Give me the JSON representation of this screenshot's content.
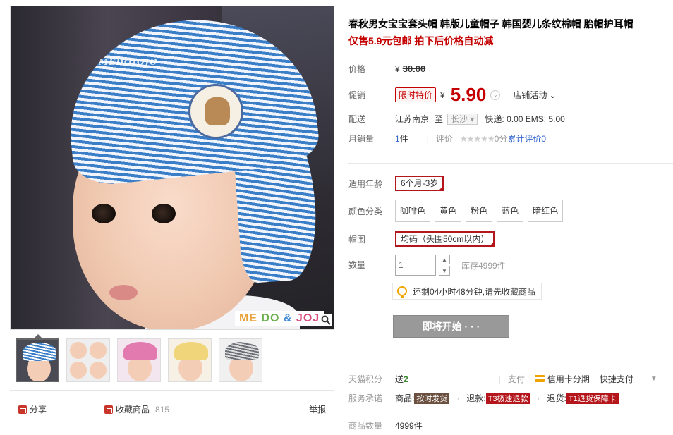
{
  "gallery": {
    "main_watermark": "MEDOJOJO",
    "brand_letters": [
      "ME",
      "DO",
      "&",
      "JOJ"
    ],
    "thumb_colors": [
      "#5a8ed0",
      "#c7a0c0",
      "#e27ab0",
      "#f1d57a",
      "#8b8f98"
    ]
  },
  "share": {
    "share_label": "分享",
    "favorite_label": "收藏商品",
    "favorite_count": "815",
    "report_label": "举报"
  },
  "product": {
    "title": "春秋男女宝宝套头帽 韩版儿童帽子 韩国婴儿条纹棉帽 胎帽护耳帽",
    "subtitle": "仅售5.9元包邮 拍下后价格自动减"
  },
  "price": {
    "label": "价格",
    "currency": "¥",
    "original": "30.00",
    "promo_label": "促销",
    "promo_tag": "限时特价",
    "current": "5.90",
    "store_activity": "店铺活动"
  },
  "shipping": {
    "label": "配送",
    "from": "江苏南京",
    "to_word": "至",
    "destination": "长沙",
    "fees": "快递: 0.00 EMS: 5.00"
  },
  "sales": {
    "label": "月销量",
    "count": "1",
    "unit": "件",
    "review_label": "评价",
    "stars": "★★★★★",
    "score": "0分",
    "total_reviews_label": "累计评价",
    "total_reviews": "0"
  },
  "options": {
    "age_label": "适用年龄",
    "age_value": "6个月-3岁",
    "color_label": "颜色分类",
    "colors": [
      "咖啡色",
      "黄色",
      "粉色",
      "蓝色",
      "暗红色"
    ],
    "size_label": "帽围",
    "size_value": "均码（头围50cm以内）",
    "qty_label": "数量",
    "qty_value": "1",
    "stock": "库存4999件"
  },
  "tip": {
    "text": "还剩04小时48分钟,请先收藏商品"
  },
  "buy": {
    "label": "即将开始 · · ·"
  },
  "services": {
    "points_label": "天猫积分",
    "points_prefix": "送",
    "points_value": "2",
    "pay_label": "支付",
    "credit_card": "信用卡分期",
    "quick_pay": "快捷支付",
    "promise_label": "服务承诺",
    "goods_label": "商品:",
    "goods_badge": "按时发货",
    "refund_label": "退款:",
    "refund_badge": "T3极速退款",
    "return_label": "退货:",
    "return_badge": "T1退货保障卡",
    "qty_label": "商品数量",
    "qty_value": "4999件"
  }
}
